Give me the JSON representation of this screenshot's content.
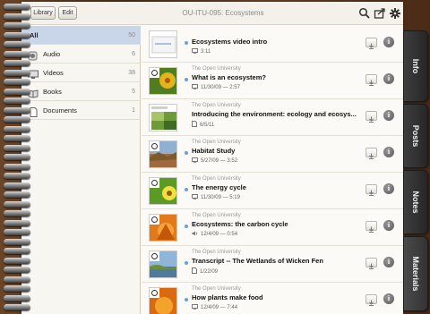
{
  "header": {
    "library_label": "Library",
    "edit_label": "Edit",
    "title": "OU-ITU-095: Ecosystems"
  },
  "sidebar": {
    "items": [
      {
        "label": "All",
        "count": "50",
        "icon": "all"
      },
      {
        "label": "Audio",
        "count": "6",
        "icon": "speaker-icon"
      },
      {
        "label": "Videos",
        "count": "38",
        "icon": "monitor-icon"
      },
      {
        "label": "Books",
        "count": "5",
        "icon": "book-icon"
      },
      {
        "label": "Documents",
        "count": "1",
        "icon": "document-icon"
      }
    ]
  },
  "list": {
    "rows": [
      {
        "publisher": "",
        "title": "Ecosystems video intro",
        "meta": "3:11",
        "meta_icon": "monitor-icon"
      },
      {
        "publisher": "The Open University",
        "title": "What is an ecosystem?",
        "meta": "11/30/09 — 2:57",
        "meta_icon": "monitor-icon"
      },
      {
        "publisher": "The Open University",
        "title": "Introducing the environment: ecology and ecosys...",
        "meta": "6/5/11",
        "meta_icon": "document-icon"
      },
      {
        "publisher": "The Open University",
        "title": "Habitat Study",
        "meta": "5/27/09 — 3:52",
        "meta_icon": "monitor-icon"
      },
      {
        "publisher": "The Open University",
        "title": "The energy cycle",
        "meta": "11/30/09 — 5:19",
        "meta_icon": "monitor-icon"
      },
      {
        "publisher": "The Open University",
        "title": "Ecosystems: the carbon cycle",
        "meta": "12/4/09 — 0:54",
        "meta_icon": "speaker-icon"
      },
      {
        "publisher": "The Open University",
        "title": "Transcript -- The Wetlands of Wicken Fen",
        "meta": "1/22/09",
        "meta_icon": "document-icon"
      },
      {
        "publisher": "The Open University",
        "title": "How plants make food",
        "meta": "12/4/09 — 7:44",
        "meta_icon": "monitor-icon"
      }
    ]
  },
  "tabs": [
    {
      "label": "Info"
    },
    {
      "label": "Posts"
    },
    {
      "label": "Notes"
    },
    {
      "label": "Materials"
    }
  ],
  "colors": {
    "accent": "#c9d5e8",
    "unread_dot": "#6e9fd6",
    "tab_bg": "#2f2f2f"
  }
}
